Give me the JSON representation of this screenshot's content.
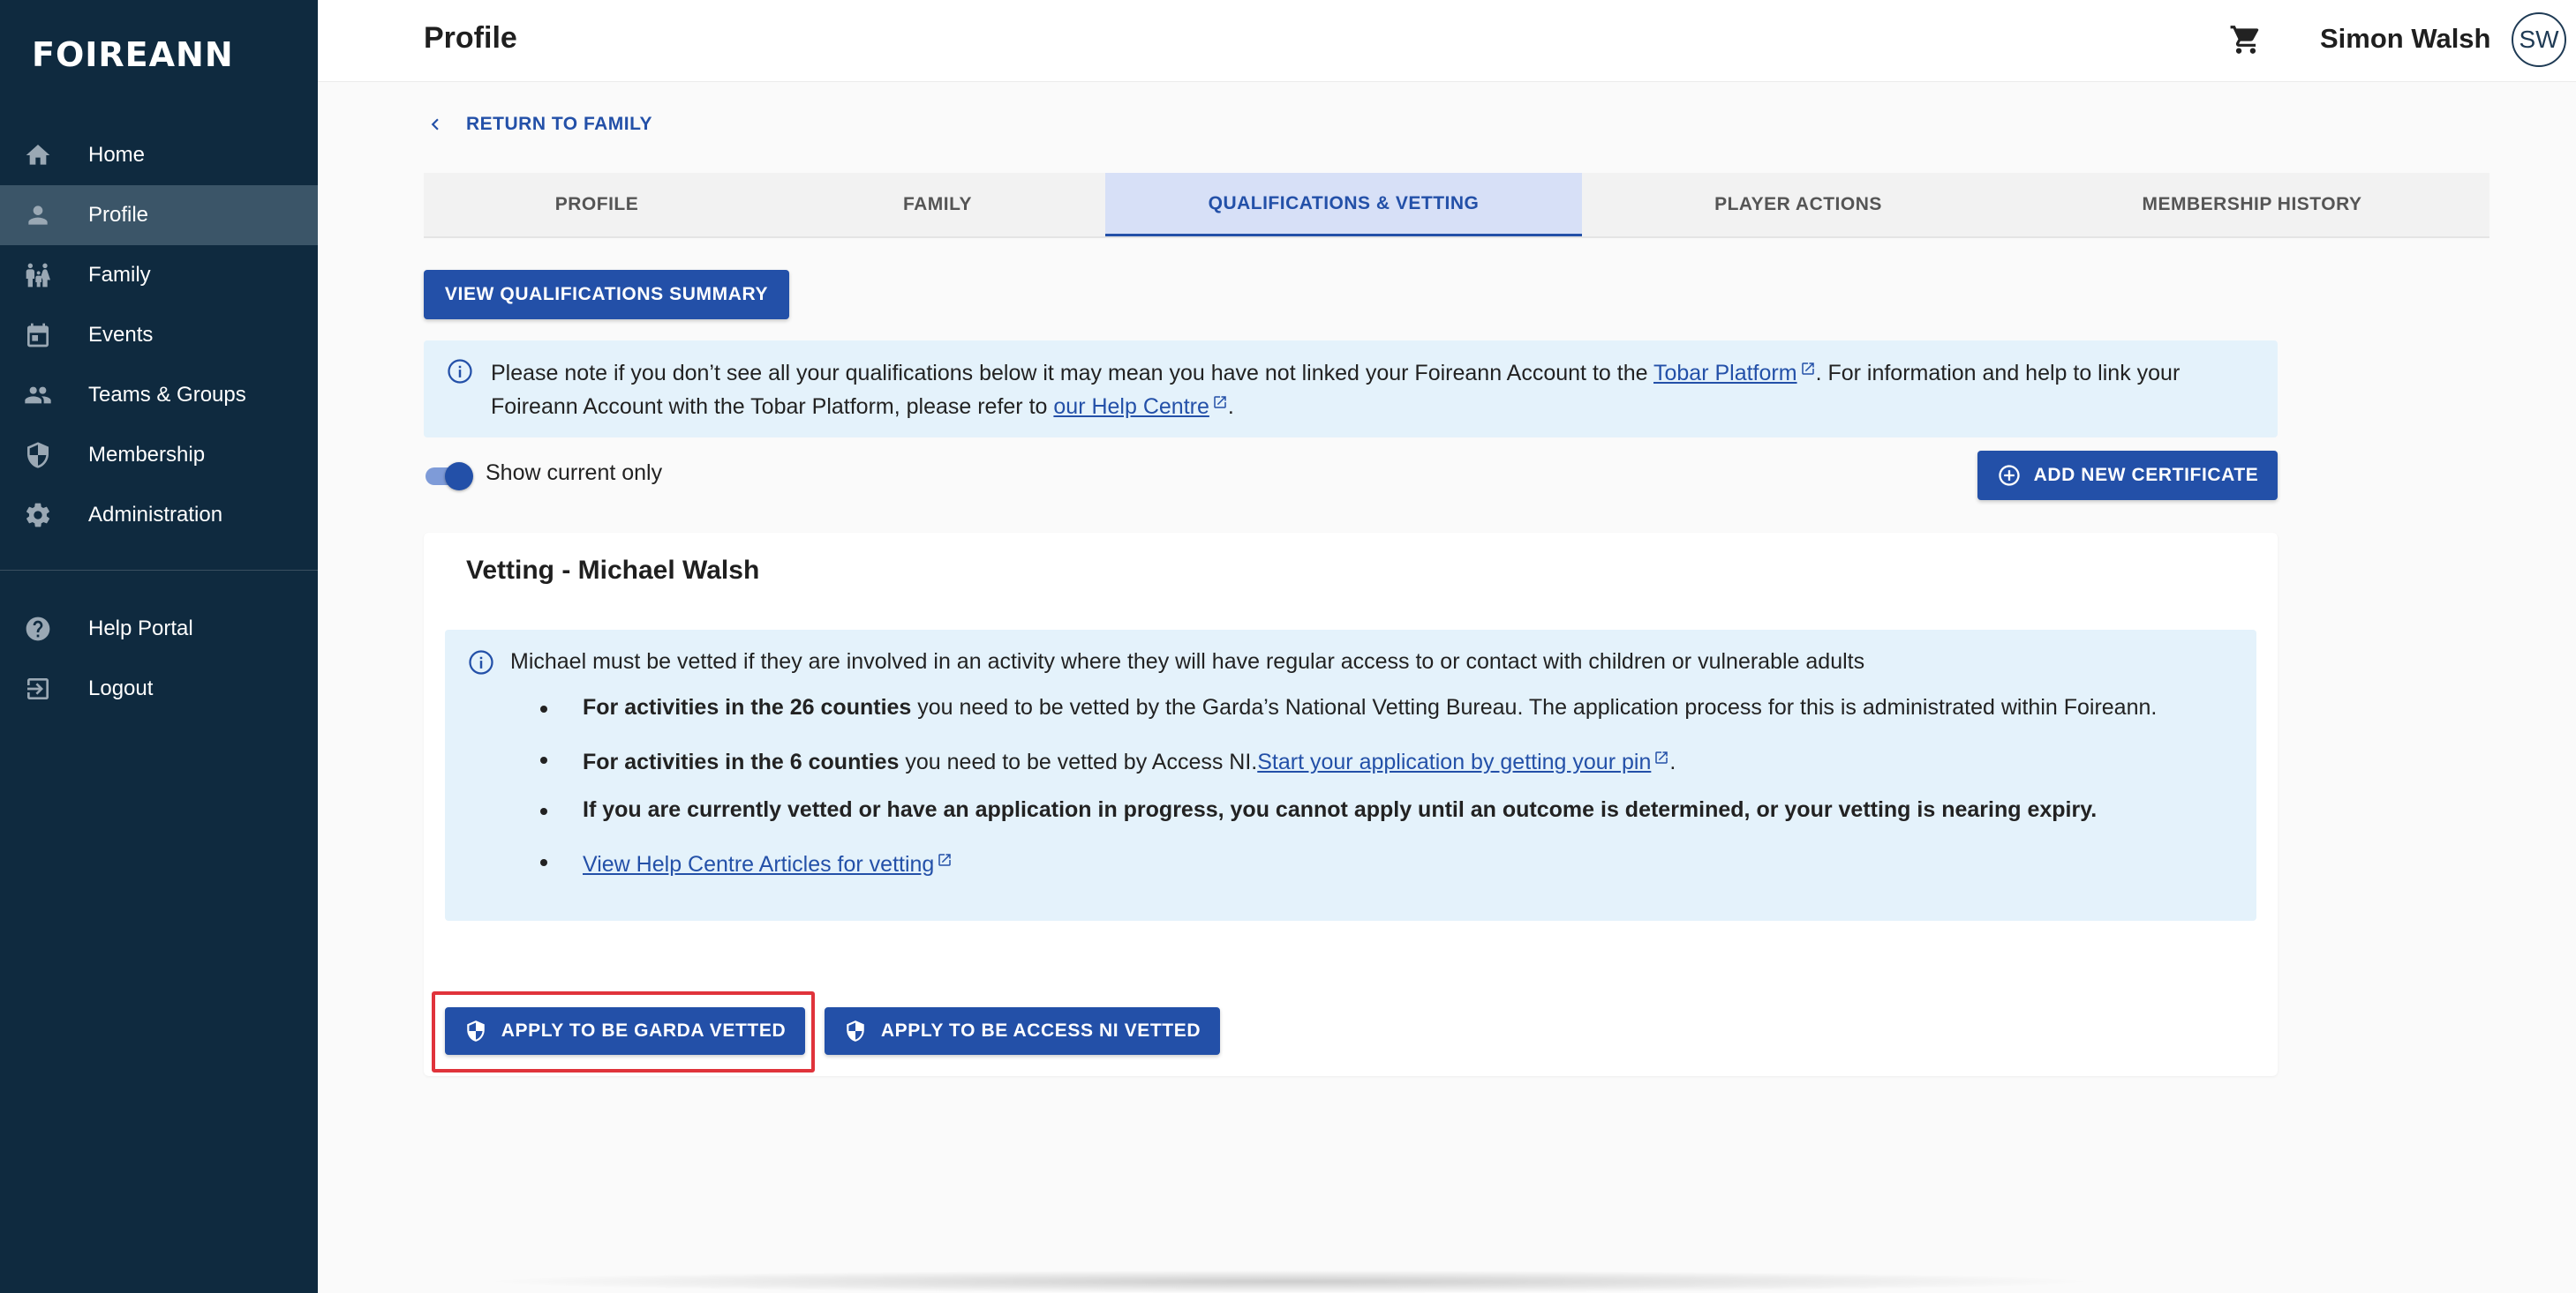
{
  "brand": {
    "logo": "FOIREANN"
  },
  "sidebar": {
    "items": [
      {
        "label": "Home",
        "icon": "home-icon"
      },
      {
        "label": "Profile",
        "icon": "person-icon",
        "active": true
      },
      {
        "label": "Family",
        "icon": "family-icon"
      },
      {
        "label": "Events",
        "icon": "calendar-icon"
      },
      {
        "label": "Teams & Groups",
        "icon": "group-icon"
      },
      {
        "label": "Membership",
        "icon": "shield-icon"
      },
      {
        "label": "Administration",
        "icon": "gear-icon"
      }
    ],
    "secondary": [
      {
        "label": "Help Portal",
        "icon": "help-icon"
      },
      {
        "label": "Logout",
        "icon": "logout-icon"
      }
    ]
  },
  "header": {
    "title": "Profile",
    "user_name": "Simon Walsh",
    "avatar_initials": "SW"
  },
  "back_link": "RETURN TO FAMILY",
  "tabs": [
    {
      "label": "PROFILE"
    },
    {
      "label": "FAMILY"
    },
    {
      "label": "QUALIFICATIONS & VETTING",
      "active": true
    },
    {
      "label": "PLAYER ACTIONS"
    },
    {
      "label": "MEMBERSHIP HISTORY"
    }
  ],
  "view_summary_label": "VIEW QUALIFICATIONS SUMMARY",
  "info_banner": {
    "text_1": "Please note if you don’t see all your qualifications below it may mean you have not linked your Foireann Account to the ",
    "link_1": "Tobar Platform",
    "text_2": ". For information and help to link your Foireann Account with the Tobar Platform, please refer to ",
    "link_2": "our Help Centre",
    "text_3": "."
  },
  "toggle": {
    "label": "Show current only",
    "on": true
  },
  "add_certificate_label": "ADD NEW CERTIFICATE",
  "vetting": {
    "title": "Vetting - Michael Walsh",
    "intro": "Michael must be vetted if they are involved in an activity where they will have regular access to or contact with children or vulnerable adults",
    "item_1_bold": "For activities in the 26 counties",
    "item_1_text": " you need to be vetted by the Garda’s National Vetting Bureau. The application process for this is administrated within Foireann.",
    "item_2_bold": "For activities in the 6 counties",
    "item_2_text": " you need to be vetted by Access NI.",
    "item_2_link": "Start your application by getting your pin",
    "item_2_end": ".",
    "item_3_bold": "If you are currently vetted or have an application in progress, you cannot apply until an outcome is determined, or your vetting is nearing expiry.",
    "item_4_link": "View Help Centre Articles for vetting",
    "apply_garda_label": "APPLY TO BE GARDA VETTED",
    "apply_ni_label": "APPLY TO BE ACCESS NI VETTED"
  },
  "colors": {
    "sidebar_bg": "#0f2a3f",
    "accent": "#2350a8",
    "info_bg": "#e4f2fb",
    "highlight": "#e0333b"
  }
}
